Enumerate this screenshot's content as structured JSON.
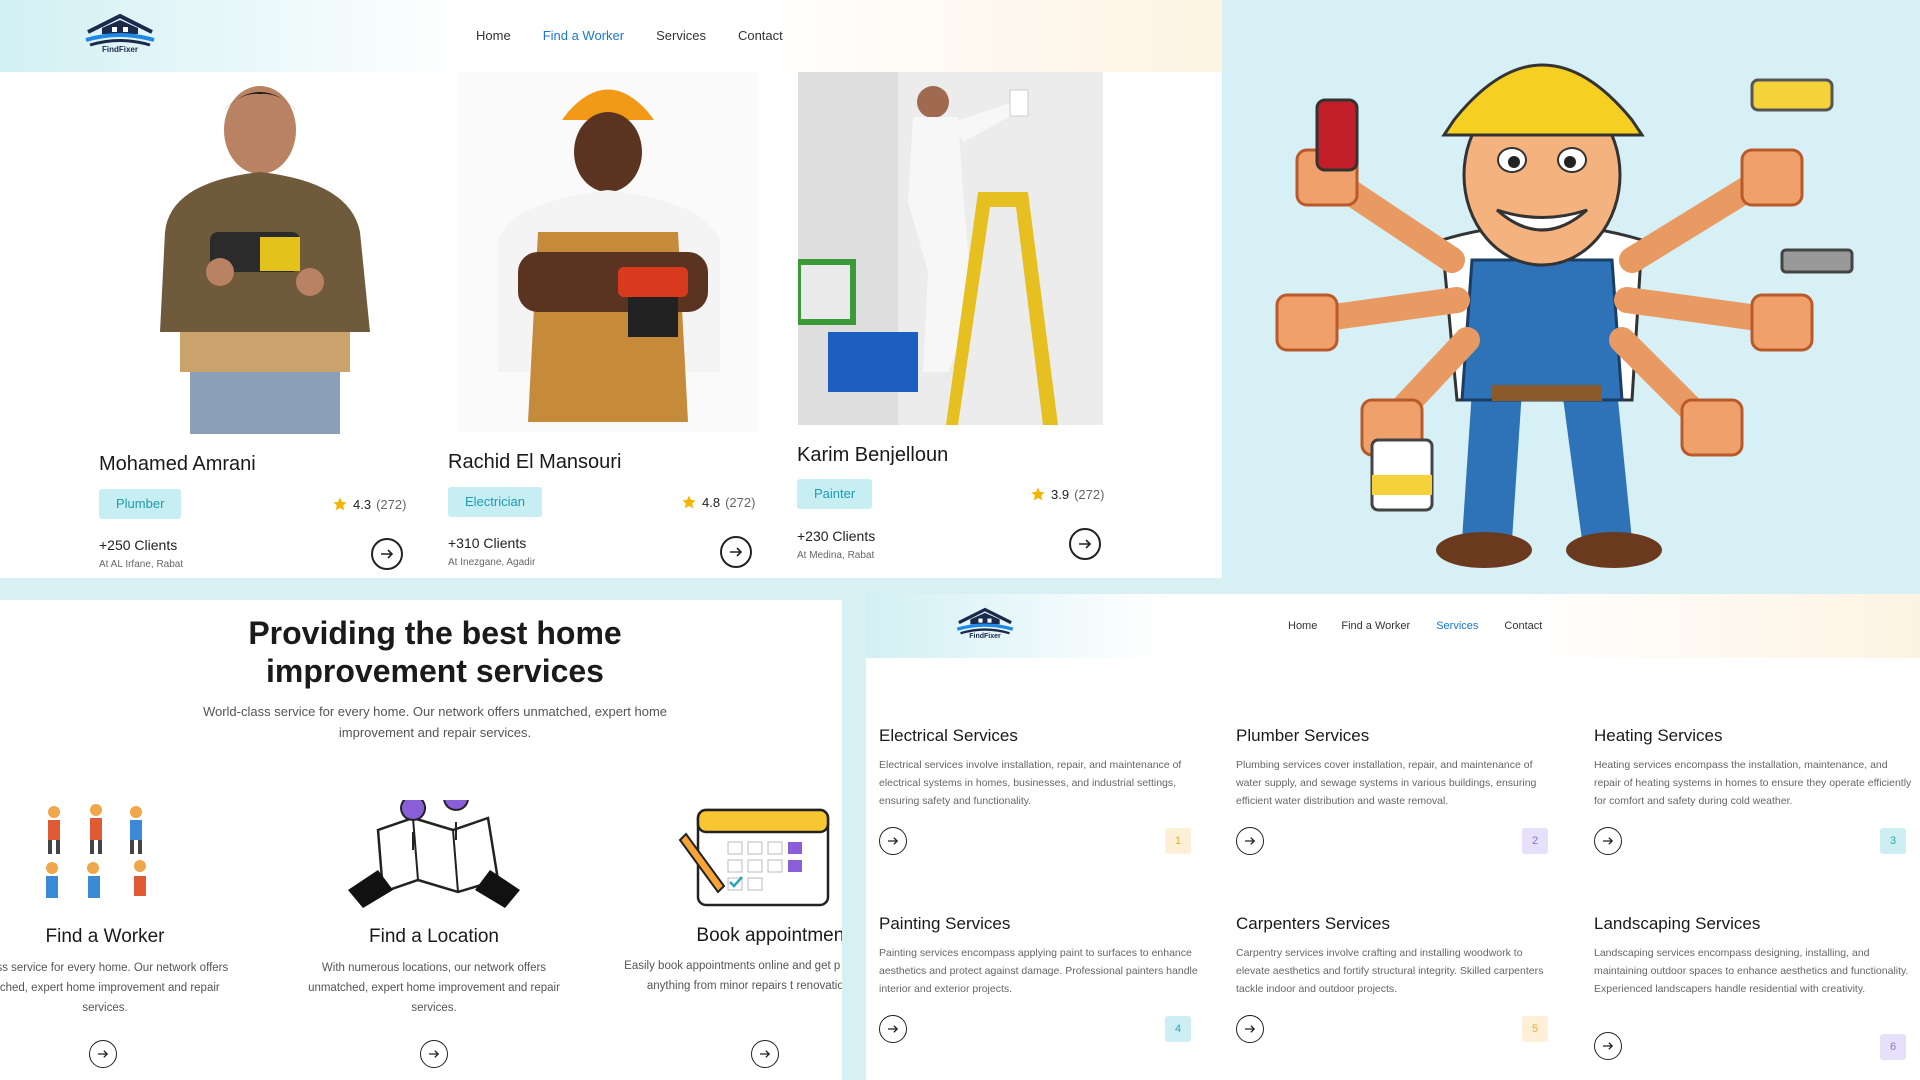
{
  "brand": {
    "name": "FindFixer"
  },
  "nav": {
    "home": "Home",
    "find_worker": "Find a Worker",
    "services": "Services",
    "contact": "Contact"
  },
  "workers": [
    {
      "name": "Mohamed Amrani",
      "role": "Plumber",
      "rating": "4.3",
      "reviews": "(272)",
      "clients": "+250 Clients",
      "location": "At AL Irfane, Rabat"
    },
    {
      "name": "Rachid El Mansouri",
      "role": "Electrician",
      "rating": "4.8",
      "reviews": "(272)",
      "clients": "+310 Clients",
      "location": "At Inezgane, Agadir"
    },
    {
      "name": "Karim Benjelloun",
      "role": "Painter",
      "rating": "3.9",
      "reviews": "(272)",
      "clients": "+230 Clients",
      "location": "At Medina, Rabat"
    }
  ],
  "intro": {
    "title_line1": "Providing the best home",
    "title_line2": "improvement services",
    "subtitle": "World-class service for every home. Our network offers unmatched, expert home improvement and repair services."
  },
  "features": [
    {
      "title": "Find a Worker",
      "desc": "class service for every home. Our network offers atched, expert home improvement and repair services."
    },
    {
      "title": "Find a Location",
      "desc": "With numerous locations, our network offers unmatched, expert home improvement and repair services."
    },
    {
      "title": "Book appointment",
      "desc": "Easily book appointments online and get p help for anything from minor repairs t renovations."
    }
  ],
  "services": [
    {
      "title": "Electrical Services",
      "desc": "Electrical services involve installation, repair, and maintenance of electrical systems in homes, businesses, and industrial settings, ensuring safety and functionality.",
      "number": "1",
      "badge_bg": "#fdf0d6",
      "badge_fg": "#e8a93a"
    },
    {
      "title": "Plumber Services",
      "desc": "Plumbing services cover installation, repair, and maintenance of water supply, and sewage systems in various buildings, ensuring efficient water distribution and waste removal.",
      "number": "2",
      "badge_bg": "#e6e0fa",
      "badge_fg": "#8a73d8"
    },
    {
      "title": "Heating Services",
      "desc": "Heating services encompass the installation, maintenance, and repair of heating systems in homes to ensure they operate efficiently for comfort and safety during cold weather.",
      "number": "3",
      "badge_bg": "#cdeff3",
      "badge_fg": "#2aa6b8"
    },
    {
      "title": "Painting Services",
      "desc": "Painting services encompass applying paint to surfaces to enhance aesthetics and protect against damage. Professional painters handle interior and exterior projects.",
      "number": "4",
      "badge_bg": "#cdeff3",
      "badge_fg": "#2aa6b8"
    },
    {
      "title": "Carpenters Services",
      "desc": "Carpentry services involve crafting and installing woodwork to elevate aesthetics and fortify structural integrity. Skilled carpenters tackle indoor and outdoor projects.",
      "number": "5",
      "badge_bg": "#fdf0d6",
      "badge_fg": "#e8a93a"
    },
    {
      "title": "Landscaping Services",
      "desc": "Landscaping services encompass designing, installing, and maintaining outdoor spaces to enhance aesthetics and functionality. Experienced landscapers handle residential with creativity.",
      "number": "6",
      "badge_bg": "#e6e0fa",
      "badge_fg": "#8a73d8"
    }
  ],
  "colors": {
    "accent": "#1976d2",
    "tag_bg": "#c7eef3",
    "tag_fg": "#1e9bb0",
    "star": "#f5b400",
    "canvas": "#d8f0f4"
  },
  "icons": [
    "house-logo-icon",
    "star-icon",
    "arrow-right-icon",
    "workers-icon",
    "map-pin-icon",
    "calendar-icon",
    "handyman-mascot"
  ]
}
